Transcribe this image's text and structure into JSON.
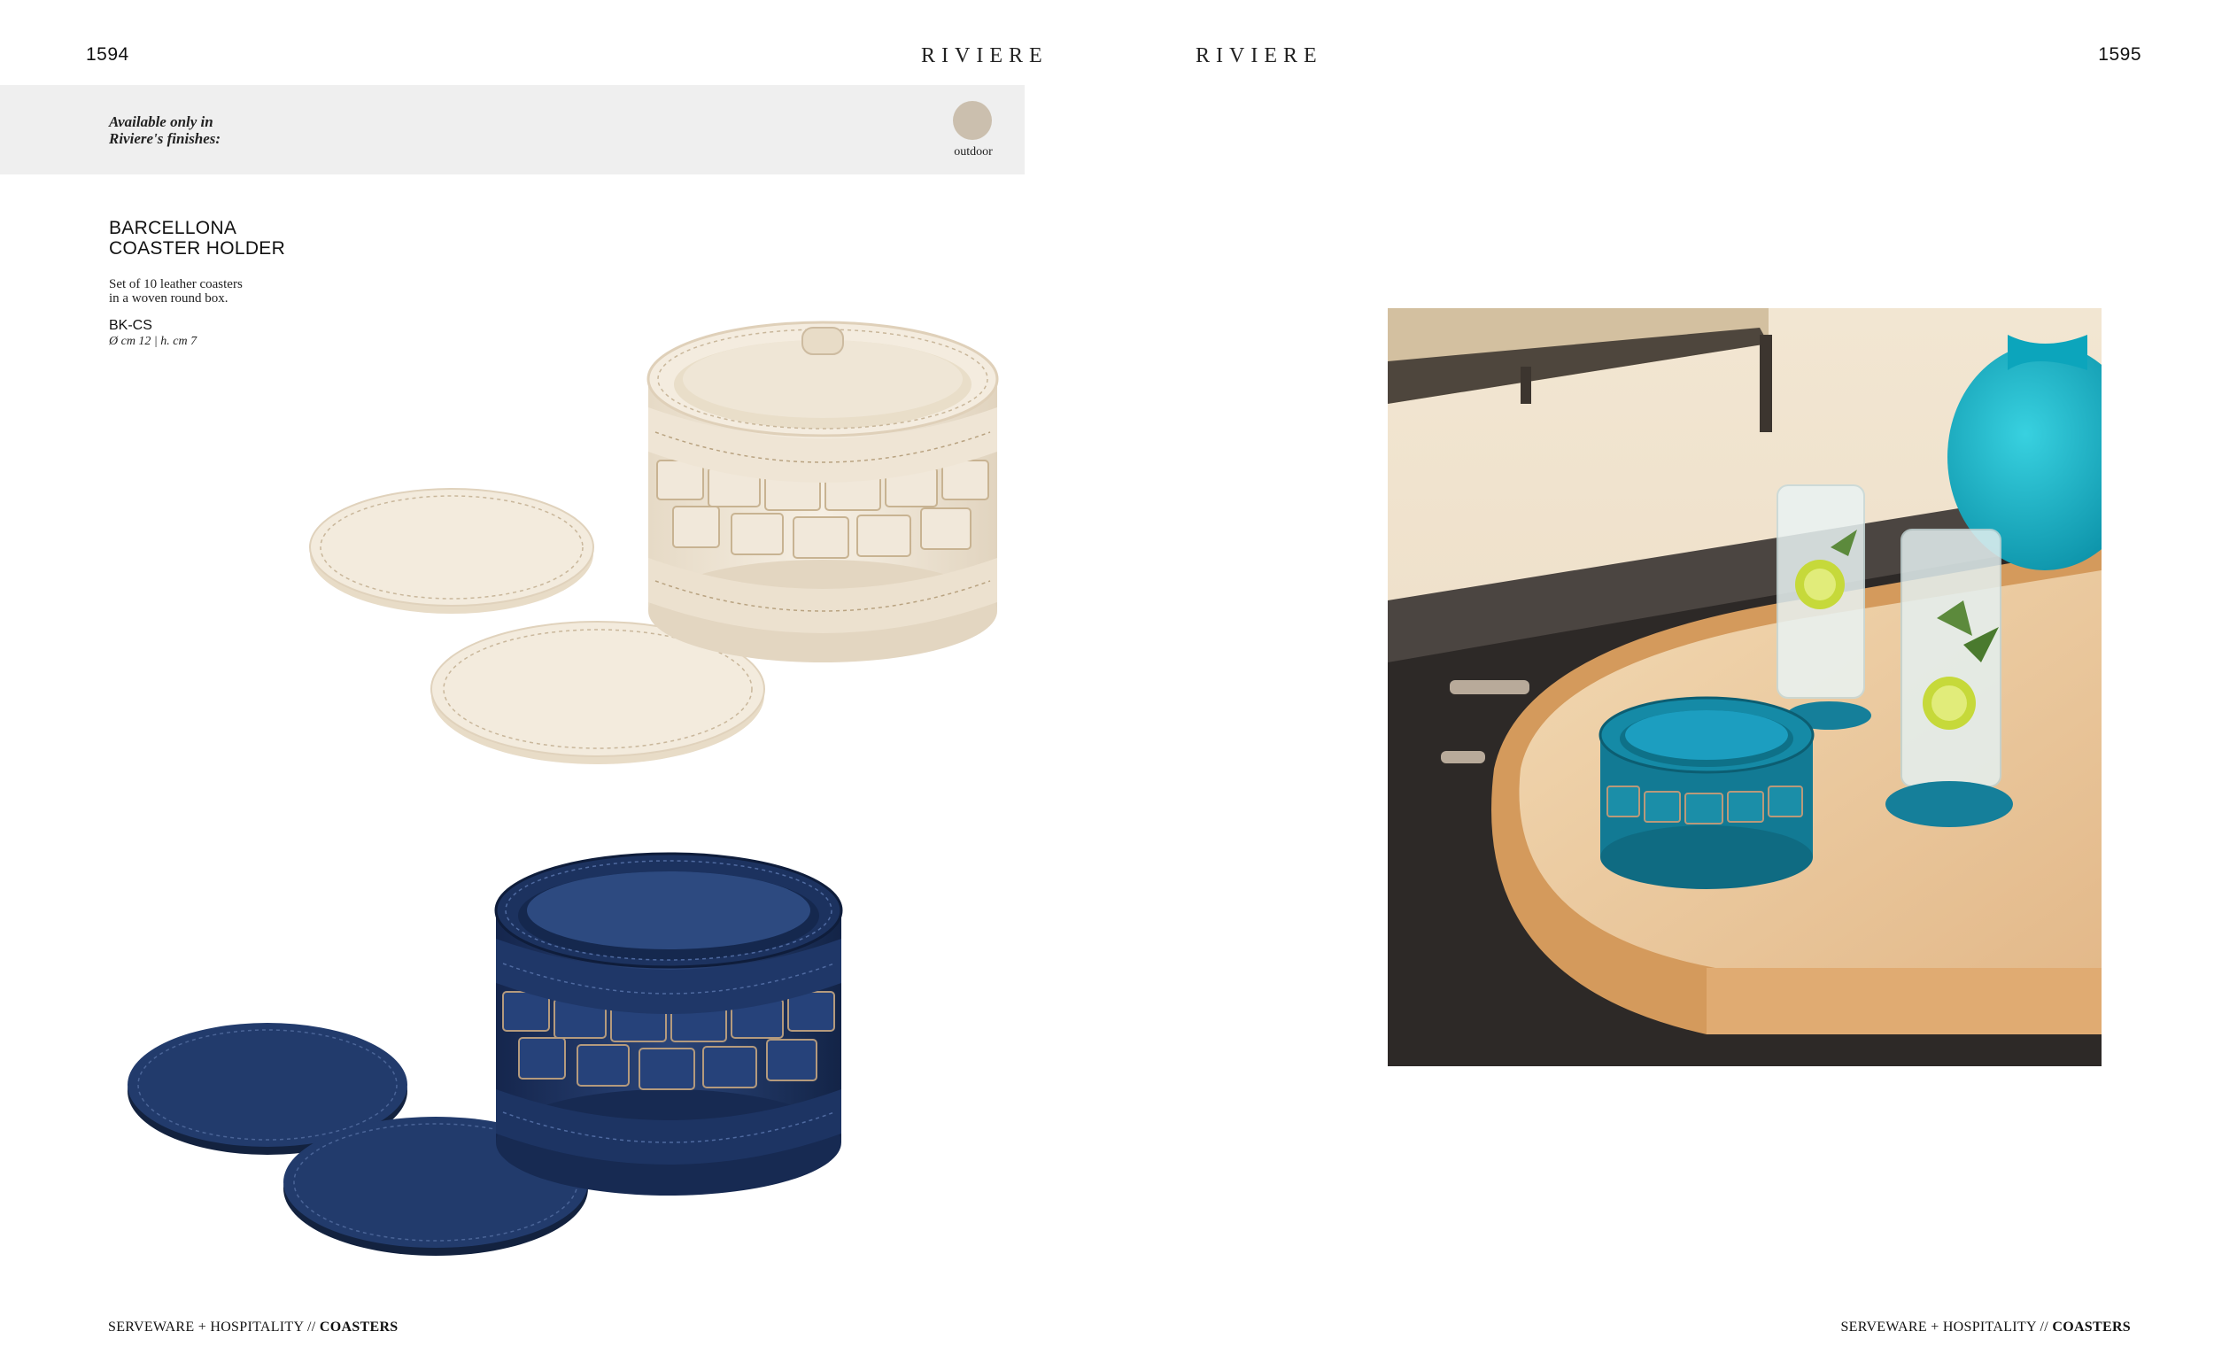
{
  "left_page": {
    "page_number": "1594",
    "brand": "RIVIERE",
    "finishes": {
      "intro_line1": "Available only in",
      "intro_line2": "Riviere's finishes:",
      "swatch_label": "outdoor",
      "swatch_color": "#cbbfae"
    },
    "product": {
      "title_line1": "BARCELLONA",
      "title_line2": "COASTER HOLDER",
      "desc_line1": "Set of 10 leather coasters",
      "desc_line2": "in a woven round box.",
      "code": "BK-CS",
      "dimensions": "Ø cm 12 | h. cm 7"
    },
    "footer": {
      "section": "SERVEWARE + HOSPITALITY // ",
      "category": "COASTERS"
    }
  },
  "right_page": {
    "page_number": "1595",
    "brand": "RIVIERE",
    "footer": {
      "section": "SERVEWARE + HOSPITALITY // ",
      "category": "COASTERS"
    }
  },
  "colors": {
    "cream_leather": "#efe4d2",
    "navy_leather": "#1e3566",
    "teal_leather": "#157f9a"
  }
}
